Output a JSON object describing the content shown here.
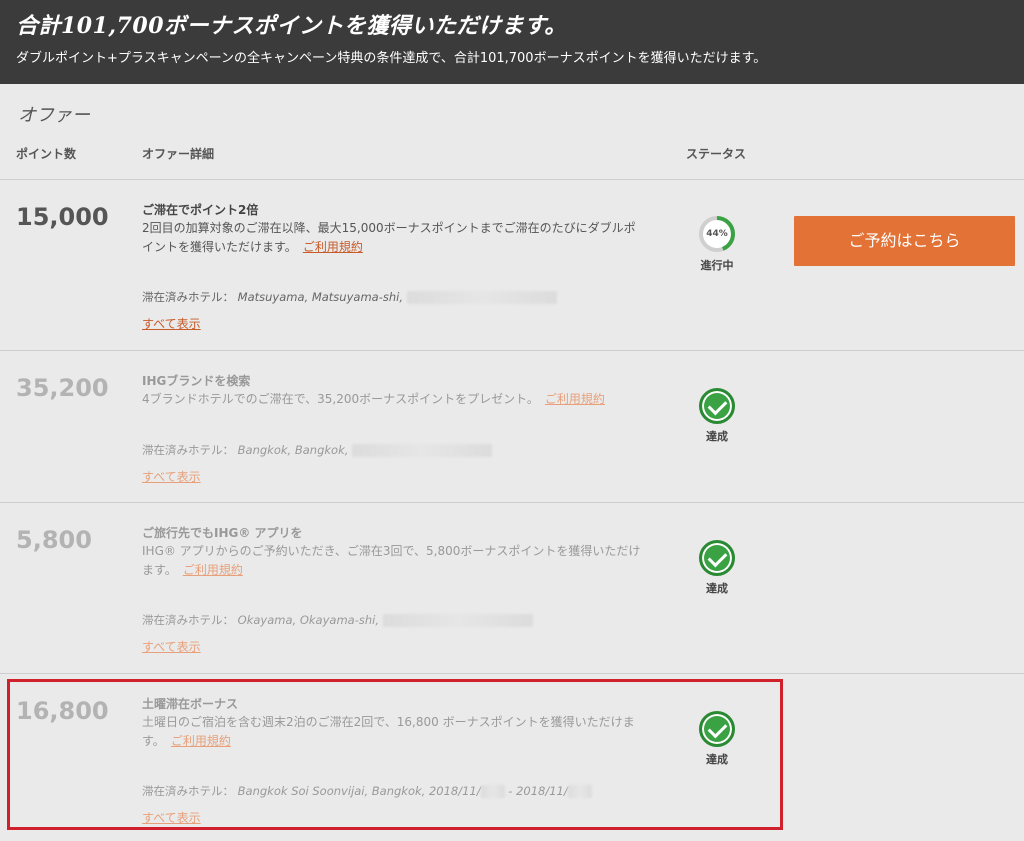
{
  "banner": {
    "title": "合計101,700ボーナスポイントを獲得いただけます。",
    "subtitle": "ダブルポイント+プラスキャンペーンの全キャンペーン特典の条件達成で、合計101,700ボーナスポイントを獲得いただけます。"
  },
  "offers_heading": "オファー",
  "columns": {
    "points": "ポイント数",
    "details": "オファー詳細",
    "status": "ステータス"
  },
  "book_button": "ご予約はこちら",
  "colors": {
    "accent": "#e27235",
    "done_green": "#3aa243",
    "highlight": "#d0202c"
  },
  "offers": [
    {
      "points": "15,000",
      "title": "ご滞在でポイント2倍",
      "desc": "2回目の加算対象のご滞在以降、最大15,000ボーナスポイントまでご滞在のたびにダブルポイントを獲得いただけます。",
      "terms": "ご利用規約",
      "hotels_label": "滞在済みホテル：",
      "hotels_value": "Matsuyama, Matsuyama-shi,",
      "show_all": "すべて表示",
      "status": "進行中",
      "progress_label": "44%",
      "progress": 0.44
    },
    {
      "points": "35,200",
      "title": "IHGブランドを検索",
      "desc": "4ブランドホテルでのご滞在で、35,200ボーナスポイントをプレゼント。",
      "terms": "ご利用規約",
      "hotels_label": "滞在済みホテル：",
      "hotels_value": "Bangkok, Bangkok,",
      "show_all": "すべて表示",
      "status": "達成"
    },
    {
      "points": "5,800",
      "title": "ご旅行先でもIHG® アプリを",
      "desc": "IHG® アプリからのご予約いただき、ご滞在3回で、5,800ボーナスポイントを獲得いただけます。",
      "terms": "ご利用規約",
      "hotels_label": "滞在済みホテル：",
      "hotels_value": "Okayama, Okayama-shi,",
      "show_all": "すべて表示",
      "status": "達成"
    },
    {
      "points": "16,800",
      "title": "土曜滞在ボーナス",
      "desc": "土曜日のご宿泊を含む週末2泊のご滞在2回で、16,800 ボーナスポイントを獲得いただけます。",
      "terms": "ご利用規約",
      "hotels_label": "滞在済みホテル：",
      "hotels_value": "Bangkok Soi Soonvijai, Bangkok, 2018/11/",
      "hotels_value2": "- 2018/11/",
      "show_all": "すべて表示",
      "status": "達成"
    }
  ]
}
